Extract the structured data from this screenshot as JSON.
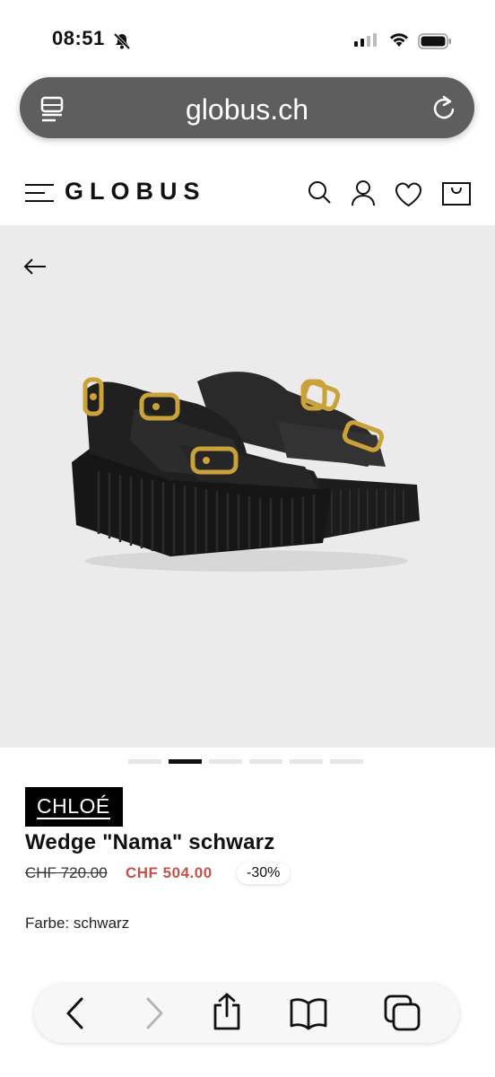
{
  "status_bar": {
    "time": "08:51"
  },
  "browser": {
    "url": "globus.ch"
  },
  "header": {
    "logo": "GLOBUS"
  },
  "product": {
    "brand": "CHLOÉ",
    "title": "Wedge \"Nama\" schwarz",
    "old_price": "CHF 720.00",
    "new_price": "CHF 504.00",
    "discount": "-30%",
    "color_label": "Farbe: schwarz",
    "gallery": {
      "image_count": 6,
      "active_index": 1
    }
  },
  "colors": {
    "sale_price": "#c0534a",
    "url_bar": "#5e5e5e",
    "image_bg": "#ebebeb"
  },
  "icons": [
    "bell-slash-icon",
    "signal-icon",
    "wifi-icon",
    "battery-icon",
    "reader-icon",
    "reload-icon",
    "menu-icon",
    "search-icon",
    "account-icon",
    "heart-icon",
    "bag-icon",
    "back-arrow-icon",
    "chevron-left-icon",
    "chevron-right-icon",
    "share-icon",
    "bookmarks-icon",
    "tabs-icon"
  ]
}
